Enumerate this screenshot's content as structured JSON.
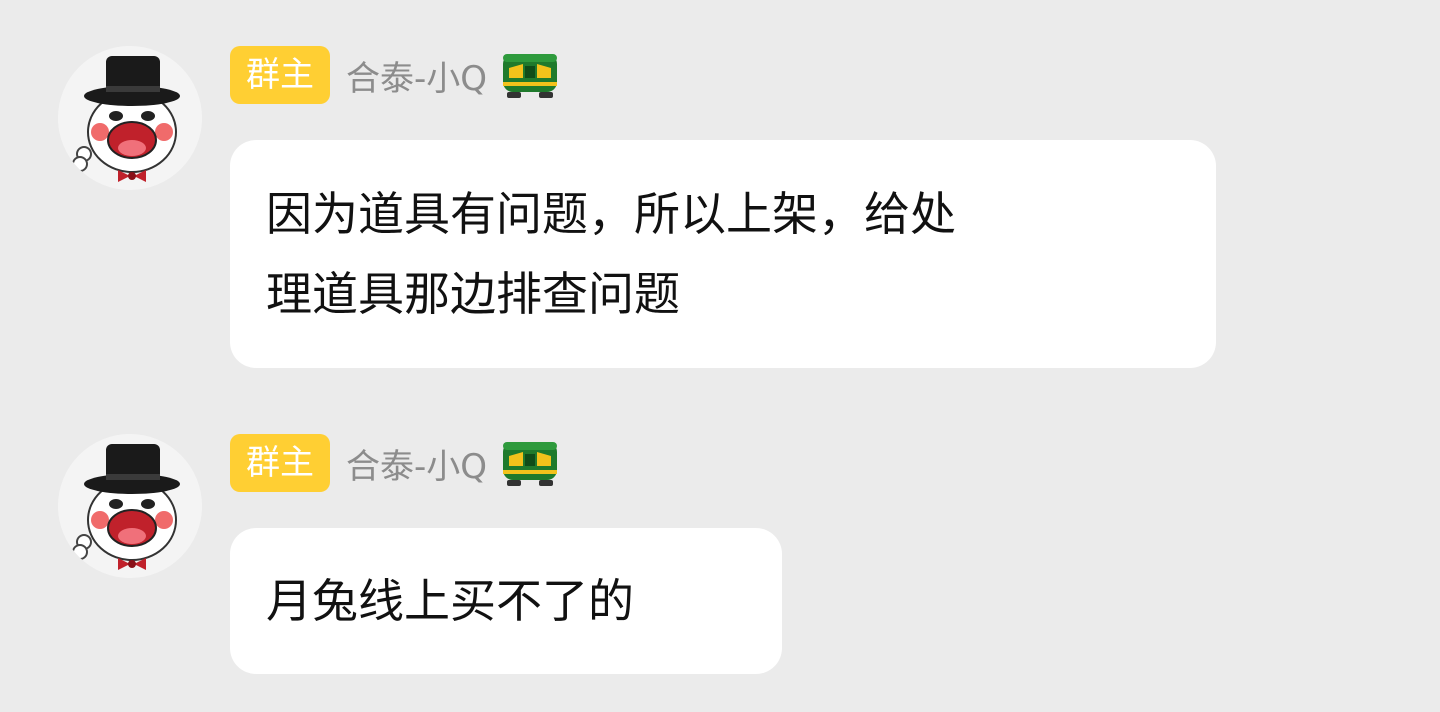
{
  "messages": [
    {
      "role_badge": "群主",
      "sender_name": "合泰-小Q",
      "badge_icon": "train-icon",
      "avatar_icon": "top-hat-mascot-avatar",
      "text_lines": [
        "因为道具有问题，所以上架，给处",
        "理道具那边排查问题"
      ]
    },
    {
      "role_badge": "群主",
      "sender_name": "合泰-小Q",
      "badge_icon": "train-icon",
      "avatar_icon": "top-hat-mascot-avatar",
      "text_lines": [
        "月兔线上买不了的"
      ]
    }
  ],
  "colors": {
    "background": "#ebebeb",
    "role_badge_bg": "#ffcf33",
    "role_badge_text": "#ffffff",
    "sender_name": "#8c8c8c",
    "bubble_bg": "#ffffff",
    "message_text": "#111111",
    "train_green": "#1f7a2c",
    "train_yellow": "#f2c21b"
  }
}
